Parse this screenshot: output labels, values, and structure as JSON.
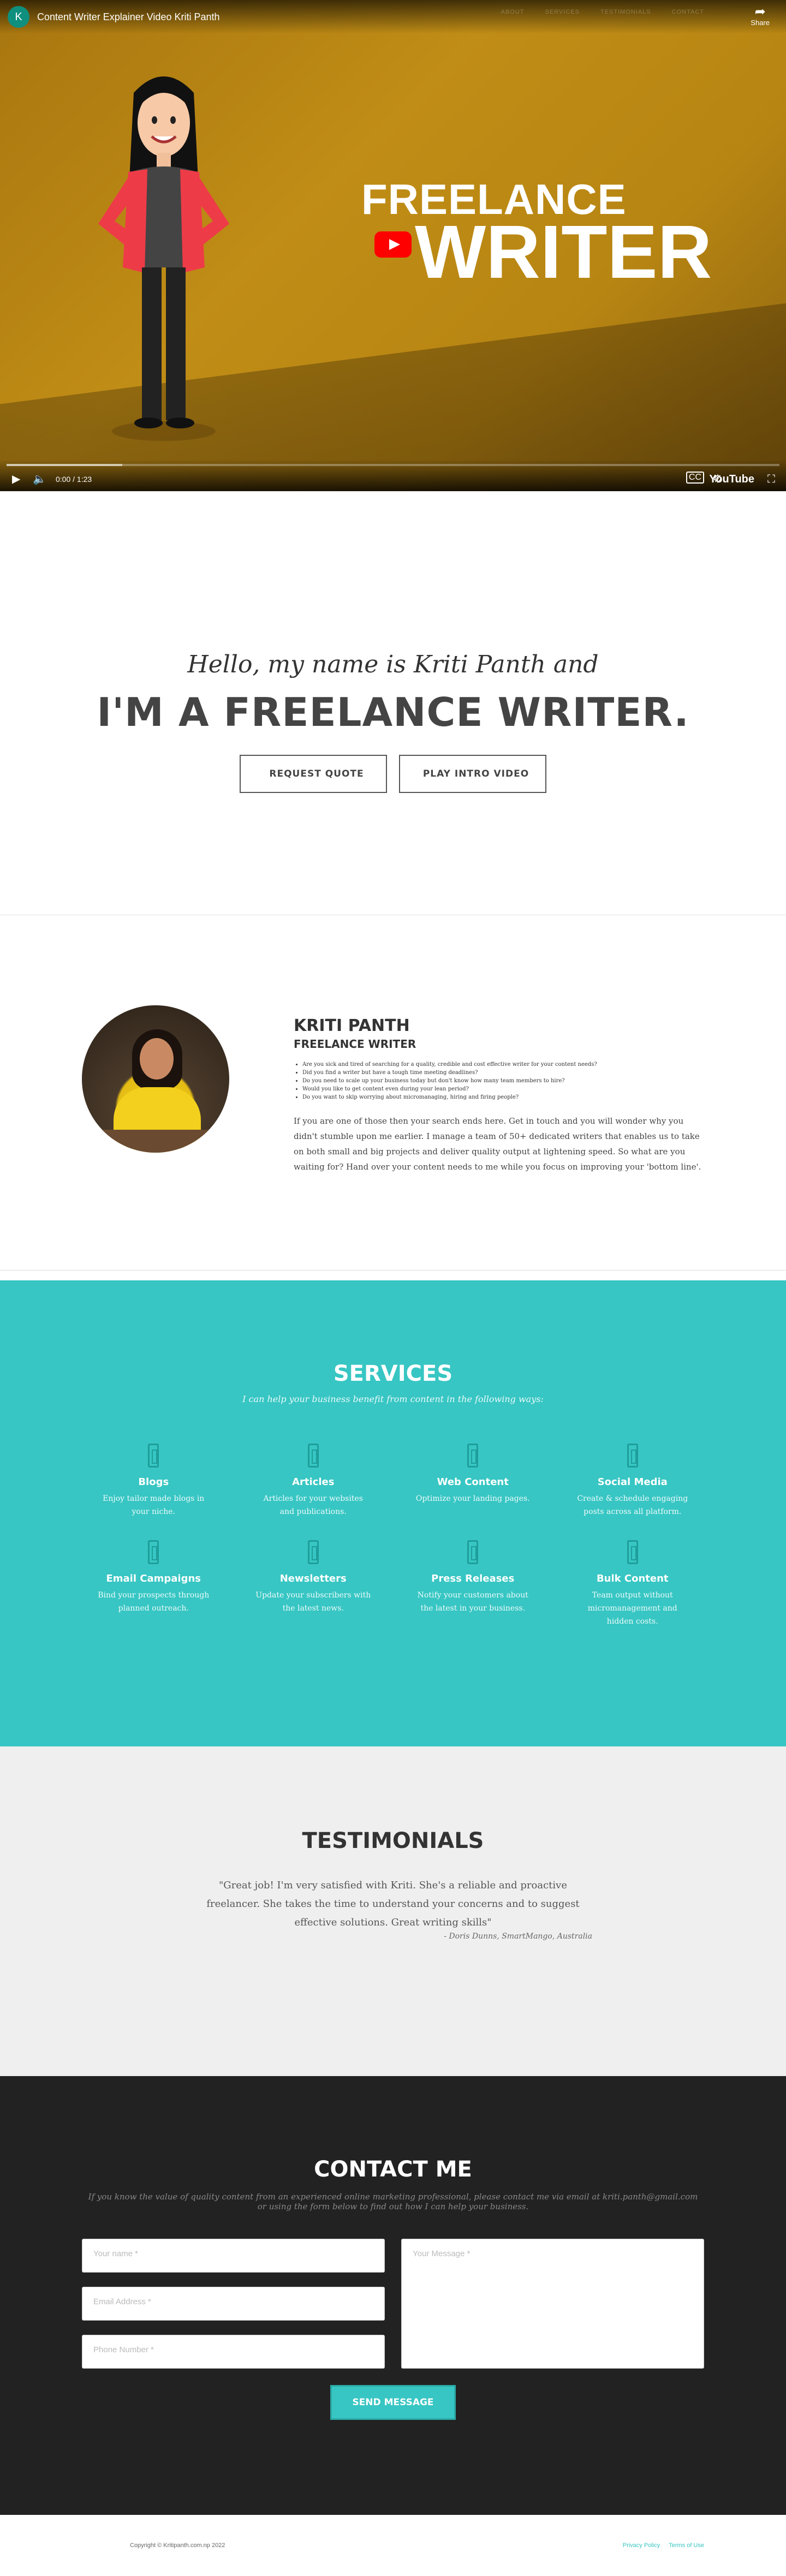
{
  "video": {
    "channel_initial": "K",
    "title": "Content Writer Explainer Video Kriti Panth",
    "ghost_nav": [
      "ABOUT",
      "SERVICES",
      "TESTIMONIALS",
      "CONTACT"
    ],
    "share_label": "Share",
    "headline_line1": "FREELANCE",
    "headline_line2": "WRITER",
    "time": "0:00 / 1:23",
    "progress": 0.15,
    "youtube_label": "YouTube"
  },
  "intro": {
    "subtitle": "Hello, my name is Kriti Panth and",
    "title": "I'M A FREELANCE WRITER.",
    "buttons": [
      {
        "icon": "",
        "label": "REQUEST QUOTE"
      },
      {
        "icon": "",
        "label": "PLAY INTRO VIDEO"
      }
    ]
  },
  "about": {
    "name": "KRITI PANTH",
    "role": "FREELANCE WRITER",
    "bullets": [
      "Are you sick and tired of searching for a quality, credible and cost effective writer for your content needs?",
      "Did you find a writer but have a tough time meeting deadlines?",
      "Do you need to scale up your business today but don't know how many team members to hire?",
      "Would you like to get content even during your lean period?",
      "Do you want to skip worrying about micromanaging, hiring and firing people?"
    ],
    "paragraph": "If you are one of those then your search ends here. Get in touch and you will wonder why you didn't stumble upon me earlier. I manage a team of 50+ dedicated writers that enables us to take on both small and big projects and deliver quality output at lightening speed. So what are you waiting for? Hand over your content needs to me while you focus on improving your 'bottom line'."
  },
  "services": {
    "title": "SERVICES",
    "subtitle": "I can help your business benefit from content in the following ways:",
    "items": [
      {
        "title": "Blogs",
        "desc": "Enjoy tailor made blogs in your niche."
      },
      {
        "title": "Articles",
        "desc": "Articles for your websites and publications."
      },
      {
        "title": "Web Content",
        "desc": "Optimize your landing pages."
      },
      {
        "title": "Social Media",
        "desc": "Create & schedule engaging posts across all platform."
      },
      {
        "title": "Email Campaigns",
        "desc": "Bind your prospects through planned outreach."
      },
      {
        "title": "Newsletters",
        "desc": "Update your subscribers with the latest news."
      },
      {
        "title": "Press Releases",
        "desc": "Notify your customers about the latest in your business."
      },
      {
        "title": "Bulk Content",
        "desc": "Team output without micromanagement and hidden costs."
      }
    ]
  },
  "testimonials": {
    "title": "TESTIMONIALS",
    "quote": "\"Great job! I'm very satisfied with Kriti. She's a reliable and proactive freelancer. She takes the time to understand your concerns and to suggest effective solutions. Great writing skills\"",
    "author": "- Doris Dunns, SmartMango, Australia"
  },
  "contact": {
    "title": "CONTACT ME",
    "subtitle": "If you know the value of quality content from an experienced online marketing professional, please contact me via email at kriti.panth@gmail.com or using the form below to find out how I can help your business.",
    "name_placeholder": "Your name *",
    "email_placeholder": "Email Address *",
    "phone_placeholder": "Phone Number *",
    "message_placeholder": "Your Message *",
    "send_label": "SEND MESSAGE"
  },
  "footer": {
    "copyright": "Copyright © Kritipanth.com.np 2022",
    "links": [
      "Privacy Policy",
      "Terms of Use"
    ]
  }
}
